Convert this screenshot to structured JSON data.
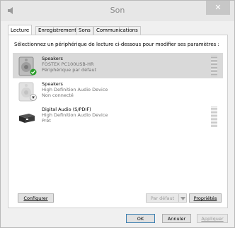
{
  "window": {
    "title": "Son",
    "close_glyph": "✕"
  },
  "tabs": [
    {
      "label": "Lecture"
    },
    {
      "label": "Enregistrement"
    },
    {
      "label": "Sons"
    },
    {
      "label": "Communications"
    }
  ],
  "instruction": "Sélectionnez un périphérique de lecture ci-dessous pour modifier ses paramètres :",
  "devices": [
    {
      "name": "Speakers",
      "line2": "FOSTEX PC100USB-HR",
      "line3": "Périphérique par défaut",
      "icon": "speaker-icon",
      "badge": "default-check-icon"
    },
    {
      "name": "Speakers",
      "line2": "High Definition Audio Device",
      "line3": "Non connecté",
      "icon": "speaker-icon",
      "badge": "down-arrow-icon"
    },
    {
      "name": "Digital Audio (S/PDIF)",
      "line2": "High Definition Audio Device",
      "line3": "Prêt",
      "icon": "digital-receiver-icon"
    }
  ],
  "buttons": {
    "configure": "Configurer",
    "set_default": "Par défaut",
    "properties": "Propriétés",
    "ok": "OK",
    "cancel": "Annuler",
    "apply": "Appliquer"
  },
  "colors": {
    "selected_bg": "#d9d9d9",
    "check_green": "#2a9d2a"
  }
}
